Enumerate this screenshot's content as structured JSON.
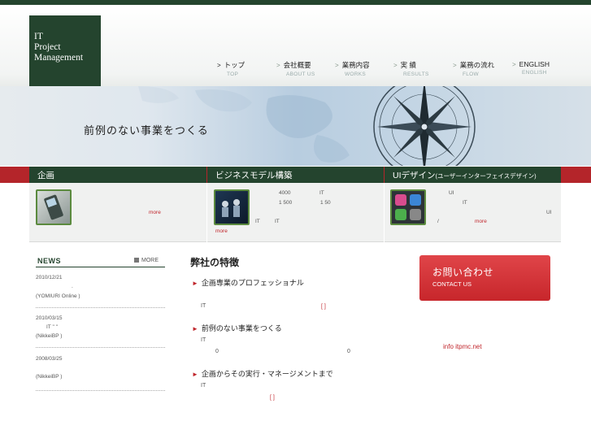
{
  "colors": {
    "brand_green": "#24442e",
    "accent_red": "#b4252a",
    "frame_green": "#5b8a3e"
  },
  "logo": {
    "line1": "IT",
    "line2": "Project",
    "line3": "Management"
  },
  "nav": [
    {
      "jp": "トップ",
      "en": "TOP",
      "arrow": ">"
    },
    {
      "jp": "会社概要",
      "en": "ABOUT US",
      "arrow": ">"
    },
    {
      "jp": "業務内容",
      "en": "WORKS",
      "arrow": ">"
    },
    {
      "jp": "実 績",
      "en": "RESULTS",
      "arrow": ">"
    },
    {
      "jp": "業務の流れ",
      "en": "FLOW",
      "arrow": ">"
    },
    {
      "jp": "ENGLISH",
      "en": "ENGLISH",
      "arrow": ">"
    }
  ],
  "hero": {
    "title": "前例のない事業をつくる"
  },
  "tabs": [
    {
      "label": "企画"
    },
    {
      "label": "ビジネスモデル構築"
    },
    {
      "label": "UIデザイン",
      "sub": "(ユーザーインターフェイスデザイン)"
    }
  ],
  "panels": {
    "p1": {
      "icon": "mobile-phone-icon",
      "more": "more"
    },
    "p2": {
      "icon": "business-meeting-icon",
      "t1": "4000",
      "t2": "IT",
      "t3": "1 500",
      "t4": "1 50",
      "t5": "IT",
      "t6": "IT",
      "more": "more"
    },
    "p3": {
      "icon": "app-icons-icon",
      "t1": "UI",
      "t2": "IT",
      "t3": "UI",
      "t4": "/",
      "more": "more"
    }
  },
  "news": {
    "title": "NEWS",
    "more": "MORE",
    "items": [
      {
        "date": "2010/12/21",
        "l1": ".",
        "l2": "(YOMIURI Online )"
      },
      {
        "date": "2010/03/15",
        "l1": "IT \" \"",
        "l2": "(NikkeiBP )"
      },
      {
        "date": "2008/03/25",
        "l1": "",
        "l2": "(NikkeiBP )"
      }
    ]
  },
  "features": {
    "title": "弊社の特徴",
    "items": [
      {
        "heading": "企画専業のプロフェッショナル",
        "a": "IT",
        "bracket": "[ ]"
      },
      {
        "heading": "前例のない事業をつくる",
        "a": "IT",
        "b": "0",
        "c": "0"
      },
      {
        "heading": "企画からその実行・マネージメントまで",
        "a": "IT",
        "bracket": "[ ]"
      }
    ]
  },
  "contact": {
    "jp": "お問い合わせ",
    "en": "CONTACT US",
    "email": "info itpmc.net"
  }
}
